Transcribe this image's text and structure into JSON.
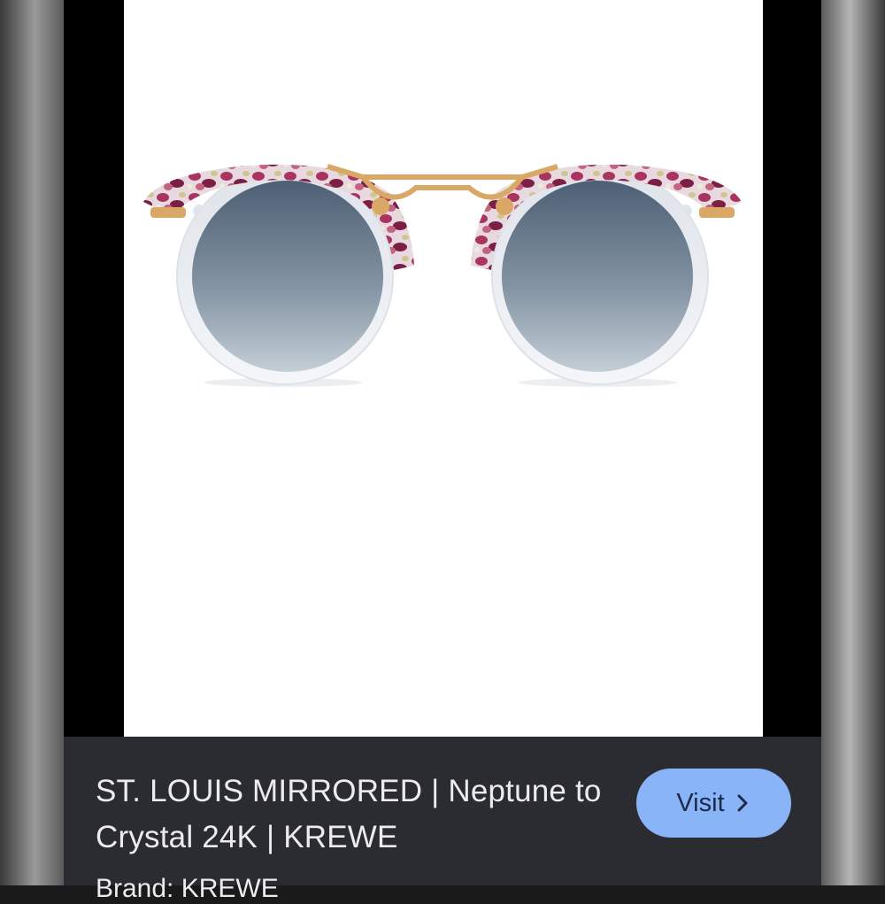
{
  "product": {
    "title": "ST. LOUIS MIRRORED | Neptune to Crystal 24K | KREWE",
    "brand_line": "Brand: KREWE",
    "image_subject": "round sunglasses with pink-tortoise and crystal frame, gold bridge, gradient blue-grey mirrored lenses"
  },
  "actions": {
    "visit_label": "Visit",
    "visit_icon": "chevron-right-icon"
  },
  "colors": {
    "panel_bg": "#2b2c31",
    "button_bg": "#8ab4f8",
    "button_text": "#1c2a45",
    "title_text": "#ececec",
    "frame_gold": "#d9a866",
    "frame_pink": "#a8345f"
  }
}
